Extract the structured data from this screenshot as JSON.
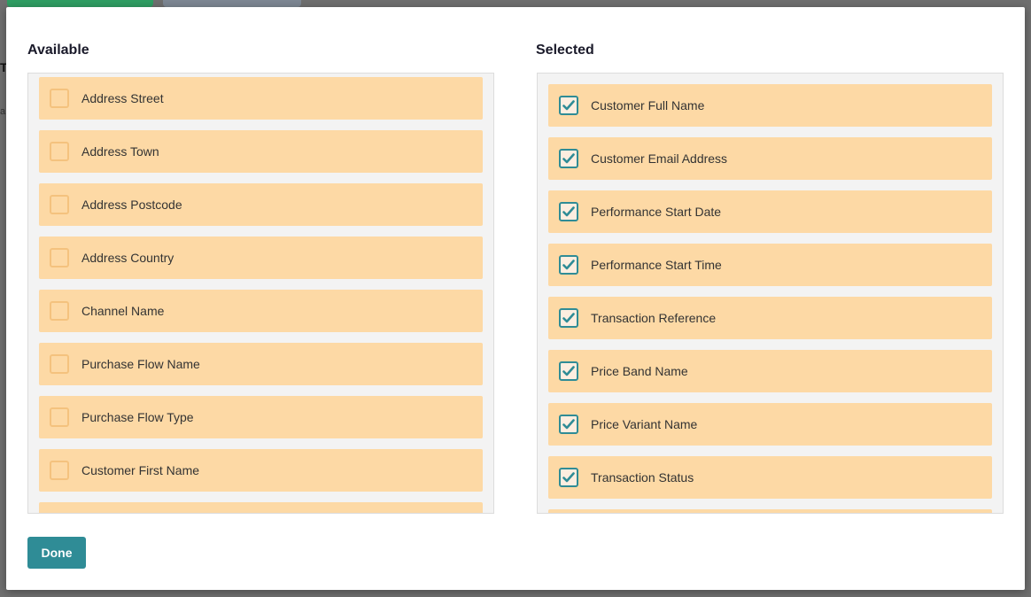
{
  "backdrop": {
    "edge_text_1": "T",
    "edge_text_2": "a"
  },
  "available": {
    "title": "Available",
    "items": [
      {
        "label": "Address Street",
        "checked": false
      },
      {
        "label": "Address Town",
        "checked": false
      },
      {
        "label": "Address Postcode",
        "checked": false
      },
      {
        "label": "Address Country",
        "checked": false
      },
      {
        "label": "Channel Name",
        "checked": false
      },
      {
        "label": "Purchase Flow Name",
        "checked": false
      },
      {
        "label": "Purchase Flow Type",
        "checked": false
      },
      {
        "label": "Customer First Name",
        "checked": false
      },
      {
        "label": "",
        "checked": false
      }
    ]
  },
  "selected": {
    "title": "Selected",
    "items": [
      {
        "label": "Customer Full Name",
        "checked": true
      },
      {
        "label": "Customer Email Address",
        "checked": true
      },
      {
        "label": "Performance Start Date",
        "checked": true
      },
      {
        "label": "Performance Start Time",
        "checked": true
      },
      {
        "label": "Transaction Reference",
        "checked": true
      },
      {
        "label": "Price Band Name",
        "checked": true
      },
      {
        "label": "Price Variant Name",
        "checked": true
      },
      {
        "label": "Transaction Status",
        "checked": true
      },
      {
        "label": "",
        "checked": true
      }
    ]
  },
  "done_label": "Done",
  "colors": {
    "item_bg": "#fdd9a5",
    "checkbox_unchecked_border": "#f4c27e",
    "checkbox_checked_border": "#2f8c96",
    "done_button": "#2f8c96"
  }
}
